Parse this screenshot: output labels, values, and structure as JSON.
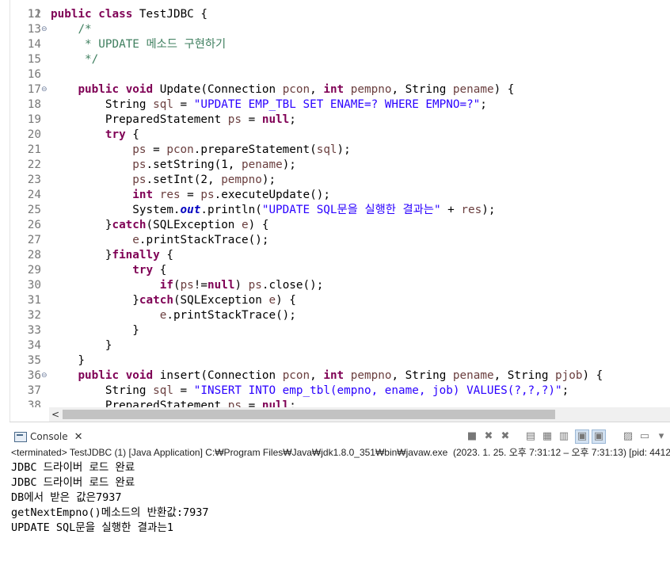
{
  "editor": {
    "top_line_number": "11",
    "lines": [
      {
        "n": "12",
        "parts": [
          [
            "kw",
            "public"
          ],
          [
            "t",
            " "
          ],
          [
            "kw",
            "class"
          ],
          [
            "t",
            " TestJDBC {"
          ]
        ]
      },
      {
        "n": "13",
        "fold": "⊖",
        "parts": [
          [
            "t",
            "    "
          ],
          [
            "cm",
            "/*"
          ]
        ]
      },
      {
        "n": "14",
        "parts": [
          [
            "t",
            "     "
          ],
          [
            "cm",
            "* UPDATE 메소드 구현하기"
          ]
        ]
      },
      {
        "n": "15",
        "parts": [
          [
            "t",
            "     "
          ],
          [
            "cm",
            "*/"
          ]
        ]
      },
      {
        "n": "16",
        "parts": []
      },
      {
        "n": "17",
        "fold": "⊖",
        "parts": [
          [
            "t",
            "    "
          ],
          [
            "kw",
            "public"
          ],
          [
            "t",
            " "
          ],
          [
            "kw",
            "void"
          ],
          [
            "t",
            " Update(Connection "
          ],
          [
            "var",
            "pcon"
          ],
          [
            "t",
            ", "
          ],
          [
            "kw",
            "int"
          ],
          [
            "t",
            " "
          ],
          [
            "var",
            "pempno"
          ],
          [
            "t",
            ", String "
          ],
          [
            "var",
            "pename"
          ],
          [
            "t",
            ") {"
          ]
        ]
      },
      {
        "n": "18",
        "parts": [
          [
            "t",
            "        String "
          ],
          [
            "var",
            "sql"
          ],
          [
            "t",
            " = "
          ],
          [
            "str",
            "\"UPDATE EMP_TBL SET ENAME=? WHERE EMPNO=?\""
          ],
          [
            "t",
            ";"
          ]
        ]
      },
      {
        "n": "19",
        "parts": [
          [
            "t",
            "        PreparedStatement "
          ],
          [
            "var",
            "ps"
          ],
          [
            "t",
            " = "
          ],
          [
            "kw",
            "null"
          ],
          [
            "t",
            ";"
          ]
        ]
      },
      {
        "n": "20",
        "parts": [
          [
            "t",
            "        "
          ],
          [
            "kw",
            "try"
          ],
          [
            "t",
            " {"
          ]
        ]
      },
      {
        "n": "21",
        "parts": [
          [
            "t",
            "            "
          ],
          [
            "var",
            "ps"
          ],
          [
            "t",
            " = "
          ],
          [
            "var",
            "pcon"
          ],
          [
            "t",
            ".prepareStatement("
          ],
          [
            "var",
            "sql"
          ],
          [
            "t",
            ");"
          ]
        ]
      },
      {
        "n": "22",
        "parts": [
          [
            "t",
            "            "
          ],
          [
            "var",
            "ps"
          ],
          [
            "t",
            ".setString(1, "
          ],
          [
            "var",
            "pename"
          ],
          [
            "t",
            ");"
          ]
        ]
      },
      {
        "n": "23",
        "parts": [
          [
            "t",
            "            "
          ],
          [
            "var",
            "ps"
          ],
          [
            "t",
            ".setInt(2, "
          ],
          [
            "var",
            "pempno"
          ],
          [
            "t",
            ");"
          ]
        ]
      },
      {
        "n": "24",
        "parts": [
          [
            "t",
            "            "
          ],
          [
            "kw",
            "int"
          ],
          [
            "t",
            " "
          ],
          [
            "var",
            "res"
          ],
          [
            "t",
            " = "
          ],
          [
            "var",
            "ps"
          ],
          [
            "t",
            ".executeUpdate();"
          ]
        ]
      },
      {
        "n": "25",
        "parts": [
          [
            "t",
            "            System."
          ],
          [
            "st",
            "out"
          ],
          [
            "t",
            ".println("
          ],
          [
            "str",
            "\"UPDATE SQL문을 실행한 결과는\""
          ],
          [
            "t",
            " + "
          ],
          [
            "var",
            "res"
          ],
          [
            "t",
            ");"
          ]
        ]
      },
      {
        "n": "26",
        "parts": [
          [
            "t",
            "        }"
          ],
          [
            "kw",
            "catch"
          ],
          [
            "t",
            "(SQLException "
          ],
          [
            "var",
            "e"
          ],
          [
            "t",
            ") {"
          ]
        ]
      },
      {
        "n": "27",
        "parts": [
          [
            "t",
            "            "
          ],
          [
            "var",
            "e"
          ],
          [
            "t",
            ".printStackTrace();"
          ]
        ]
      },
      {
        "n": "28",
        "parts": [
          [
            "t",
            "        }"
          ],
          [
            "kw",
            "finally"
          ],
          [
            "t",
            " {"
          ]
        ]
      },
      {
        "n": "29",
        "parts": [
          [
            "t",
            "            "
          ],
          [
            "kw",
            "try"
          ],
          [
            "t",
            " {"
          ]
        ]
      },
      {
        "n": "30",
        "parts": [
          [
            "t",
            "                "
          ],
          [
            "kw",
            "if"
          ],
          [
            "t",
            "("
          ],
          [
            "var",
            "ps"
          ],
          [
            "t",
            "!="
          ],
          [
            "kw",
            "null"
          ],
          [
            "t",
            ") "
          ],
          [
            "var",
            "ps"
          ],
          [
            "t",
            ".close();"
          ]
        ]
      },
      {
        "n": "31",
        "parts": [
          [
            "t",
            "            }"
          ],
          [
            "kw",
            "catch"
          ],
          [
            "t",
            "(SQLException "
          ],
          [
            "var",
            "e"
          ],
          [
            "t",
            ") {"
          ]
        ]
      },
      {
        "n": "32",
        "parts": [
          [
            "t",
            "                "
          ],
          [
            "var",
            "e"
          ],
          [
            "t",
            ".printStackTrace();"
          ]
        ]
      },
      {
        "n": "33",
        "parts": [
          [
            "t",
            "            }"
          ]
        ]
      },
      {
        "n": "34",
        "parts": [
          [
            "t",
            "        }"
          ]
        ]
      },
      {
        "n": "35",
        "parts": [
          [
            "t",
            "    }"
          ]
        ]
      },
      {
        "n": "36",
        "fold": "⊖",
        "parts": [
          [
            "t",
            "    "
          ],
          [
            "kw",
            "public"
          ],
          [
            "t",
            " "
          ],
          [
            "kw",
            "void"
          ],
          [
            "t",
            " insert(Connection "
          ],
          [
            "var",
            "pcon"
          ],
          [
            "t",
            ", "
          ],
          [
            "kw",
            "int"
          ],
          [
            "t",
            " "
          ],
          [
            "var",
            "pempno"
          ],
          [
            "t",
            ", String "
          ],
          [
            "var",
            "pename"
          ],
          [
            "t",
            ", String "
          ],
          [
            "var",
            "pjob"
          ],
          [
            "t",
            ") {"
          ]
        ]
      },
      {
        "n": "37",
        "parts": [
          [
            "t",
            "        String "
          ],
          [
            "var",
            "sql"
          ],
          [
            "t",
            " = "
          ],
          [
            "str",
            "\"INSERT INTO emp_tbl(empno, ename, job) VALUES(?,?,?)\""
          ],
          [
            "t",
            ";"
          ]
        ]
      },
      {
        "n": "38",
        "parts": [
          [
            "t",
            "        PreparedStatement "
          ],
          [
            "var",
            "ps"
          ],
          [
            "t",
            " = "
          ],
          [
            "kw",
            "null"
          ],
          [
            "t",
            ";"
          ]
        ]
      }
    ]
  },
  "scrollbar": {
    "left_arrow": "<"
  },
  "console": {
    "tab_label": "Console",
    "tab_close": "✕",
    "toolbar": [
      {
        "name": "terminate-icon",
        "glyph": "■",
        "active": false
      },
      {
        "name": "remove-launch-icon",
        "glyph": "✖",
        "active": false
      },
      {
        "name": "remove-all-terminated-icon",
        "glyph": "✖",
        "active": false
      },
      {
        "name": "scroll-lock-icon",
        "glyph": "▤",
        "active": false
      },
      {
        "name": "word-wrap-icon",
        "glyph": "▦",
        "active": false
      },
      {
        "name": "clear-console-icon",
        "glyph": "▥",
        "active": false
      },
      {
        "name": "show-on-stdout-icon",
        "glyph": "▣",
        "active": true
      },
      {
        "name": "show-on-stderr-icon",
        "glyph": "▣",
        "active": true
      },
      {
        "name": "pin-console-icon",
        "glyph": "▨",
        "active": false
      },
      {
        "name": "display-selected-console-icon",
        "glyph": "▭",
        "active": false
      },
      {
        "name": "view-menu-icon",
        "glyph": "▾",
        "active": false
      }
    ],
    "process_label": "<terminated> TestJDBC (1) [Java Application] C:₩Program Files₩Java₩jdk1.8.0_351₩bin₩javaw.exe  (2023. 1. 25. 오후 7:31:12 – 오후 7:31:13) [pid: 4412",
    "output": [
      "JDBC 드라이버 로드 완료",
      "JDBC 드라이버 로드 완료",
      "DB에서 받은 값은7937",
      "getNextEmpno()메소드의 반환값:7937",
      "UPDATE SQL문을 실행한 결과는1"
    ]
  }
}
